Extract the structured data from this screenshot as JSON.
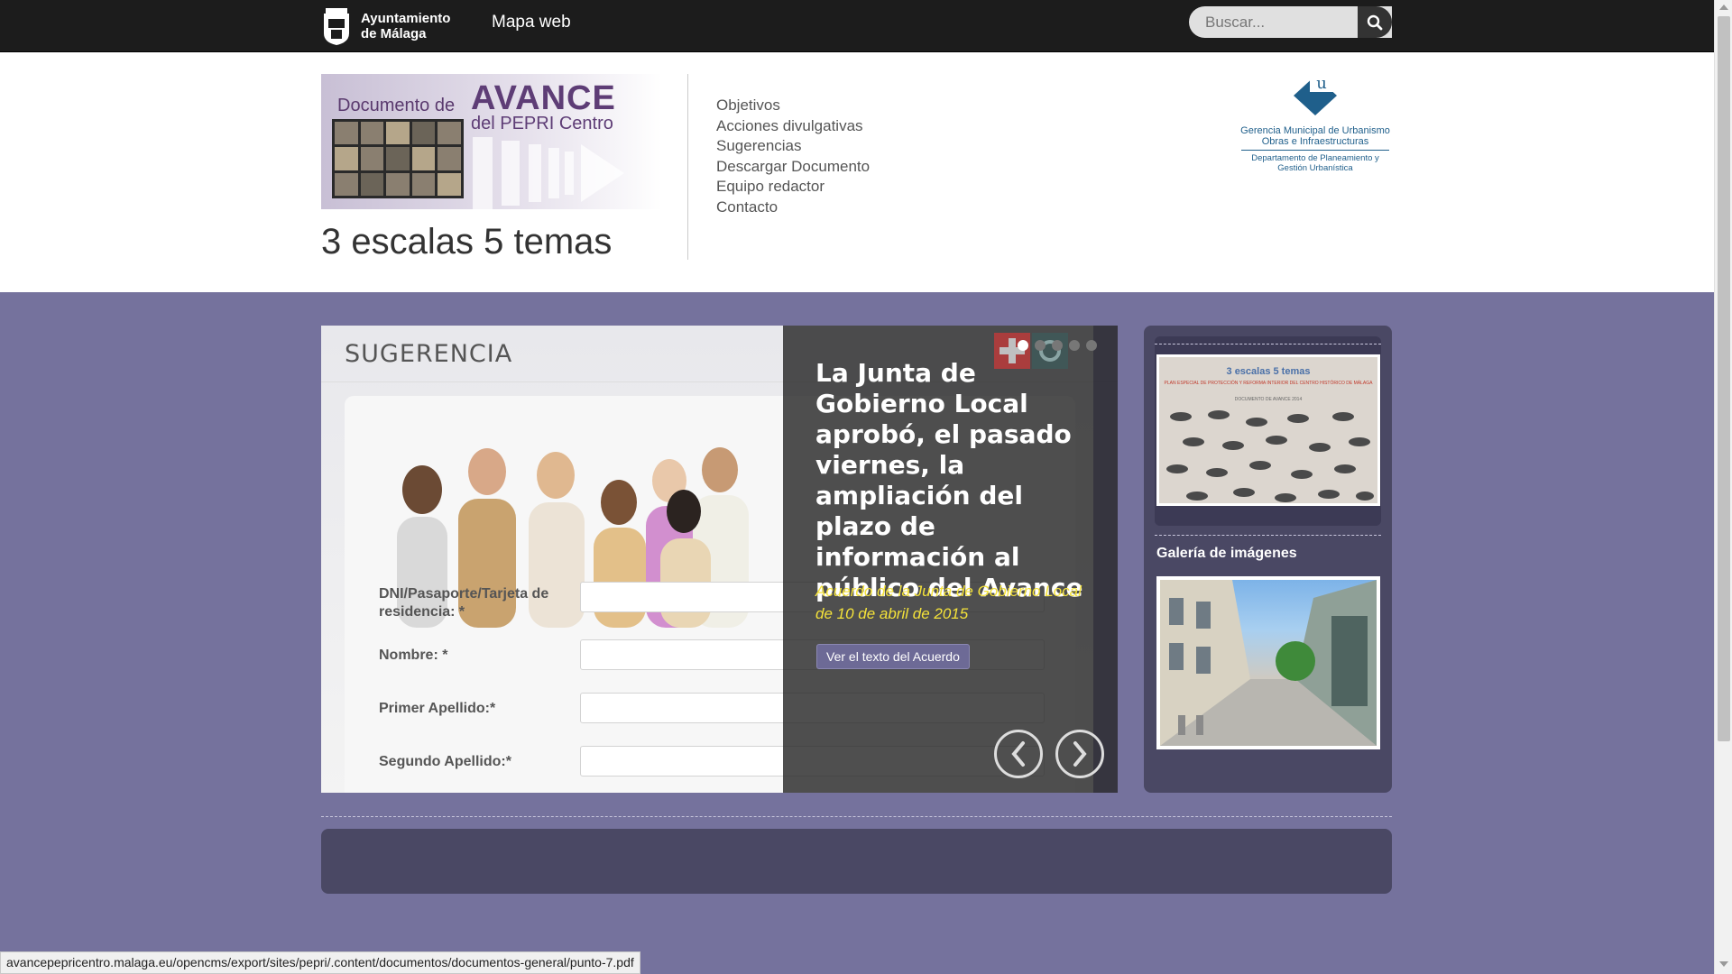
{
  "topbar": {
    "logo_line1": "Ayuntamiento",
    "logo_line2": "de Málaga",
    "sitemap_link": "Mapa web",
    "search_placeholder": "Buscar...",
    "search_icon": "search-icon"
  },
  "header": {
    "banner": {
      "line1": "Documento de",
      "line2": "AVANCE",
      "line3": "del PEPRI Centro"
    },
    "subtitle": "3 escalas 5 temas",
    "nav": [
      "Objetivos",
      "Acciones divulgativas",
      "Sugerencias",
      "Descargar Documento",
      "Equipo redactor",
      "Contacto"
    ],
    "gmu_logo": {
      "line1": "Gerencia Municipal de Urbanismo",
      "line2": "Obras e Infraestructuras",
      "line3": "Departamento de Planeamiento y",
      "line4": "Gestión Urbanística"
    }
  },
  "slider": {
    "form_title": "SUGERENCIA",
    "form_fields": [
      "DNI/Pasaporte/Tarjeta de residencia: *",
      "Nombre: *",
      "Primer Apellido:*",
      "Segundo Apellido:*"
    ],
    "heading": "La Junta de Gobierno Local aprobó, el pasado viernes, la ampliación del plazo de información al público del Avance",
    "subheading": "Acuerdo de la Junta de Gobierno Local de 10 de abril de 2015",
    "button_label": "Ver el texto del Acuerdo",
    "dots_count": 5,
    "active_dot": 1,
    "prev_label": "❮",
    "next_label": "❯"
  },
  "sidebar": {
    "doc_thumb_title": "3 escalas 5 temas",
    "doc_thumb_sub1": "PLAN ESPECIAL DE PROTECCIÓN Y REFORMA INTERIOR DEL CENTRO HISTÓRICO DE MÁLAGA",
    "doc_thumb_sub2": "DOCUMENTO DE AVANCE 2014",
    "gallery_title": "Galería de imágenes"
  },
  "statusbar": {
    "url": "avancepepricentro.malaga.eu/opencms/export/sites/pepri/.content/documentos/documentos-general/punto-7.pdf"
  },
  "colors": {
    "topbar": "#1c1c1c",
    "main_band": "#75729d",
    "panel": "#4a4864",
    "accent_yellow": "#f4e23a",
    "banner_purple": "#5e3d76"
  }
}
